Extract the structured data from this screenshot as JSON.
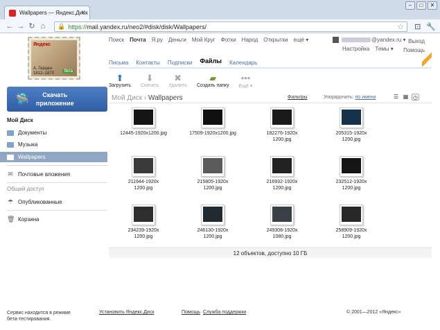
{
  "browser": {
    "tab_title": "Wallpapers — Яндекс.Диск",
    "url_scheme": "https://",
    "url_rest": "mail.yandex.ru/neo2/#disk/disk/Wallpapers/"
  },
  "logo": {
    "brand": "Яндекс",
    "name": "А. Герцен",
    "years": "1812–1870",
    "badge": "бета"
  },
  "topnav": [
    "Поиск",
    "Почта",
    "Я.ру",
    "Деньги",
    "Мой Круг",
    "Фотки",
    "Народ",
    "Открытки",
    "ещё ▾"
  ],
  "user": {
    "email_suffix": "@yandex.ru ▾",
    "settings": "Настройка",
    "themes": "Темы ▾",
    "exit": "Выход",
    "help": "Помощь"
  },
  "svctabs": [
    "Письма",
    "Контакты",
    "Подписки",
    "Файлы",
    "Календарь"
  ],
  "actions": [
    {
      "icon": "upload-icon",
      "glyph": "⬆",
      "label": "Загрузить"
    },
    {
      "icon": "download-icon",
      "glyph": "⬇",
      "label": "Скачать"
    },
    {
      "icon": "delete-icon",
      "glyph": "✖",
      "label": "Удалить"
    },
    {
      "icon": "new-folder-icon",
      "glyph": "▰",
      "label": "Создать папку"
    },
    {
      "icon": "more-icon",
      "glyph": "•••",
      "label": "Ещё ▾"
    }
  ],
  "breadcrumb": {
    "root": "Мой Диск",
    "sep": "›",
    "current": "Wallpapers"
  },
  "filters": "Фильтры",
  "sort": {
    "label": "Упорядочить:",
    "value": "по имени"
  },
  "sidebar": {
    "download_app": [
      "Скачать",
      "приложение"
    ],
    "title": "Мой Диск",
    "items": [
      "Документы",
      "Музыка",
      "Wallpapers"
    ],
    "attachments": "Почтовые вложения",
    "shared_section": "Общий доступ",
    "published": "Опубликованные",
    "trash": "Корзина"
  },
  "files": [
    {
      "name": [
        "12445-1920x1200.jpg"
      ],
      "shade": "#151515"
    },
    {
      "name": [
        "17509-1920x1200.jpg"
      ],
      "shade": "#101010"
    },
    {
      "name": [
        "182276-1920x",
        "1200.jpg"
      ],
      "shade": "#1a1a1a"
    },
    {
      "name": [
        "205315-1920x",
        "1200.jpg"
      ],
      "shade": "#16314a"
    },
    {
      "name": [
        "211944-1920x",
        "1200.jpg"
      ],
      "shade": "#3a3a3a"
    },
    {
      "name": [
        "215805-1920x",
        "1200.jpg"
      ],
      "shade": "#5a5a5a"
    },
    {
      "name": [
        "216932-1920x",
        "1200.jpg"
      ],
      "shade": "#222"
    },
    {
      "name": [
        "232512-1920x",
        "1200.jpg"
      ],
      "shade": "#141414"
    },
    {
      "name": [
        "234239-1920x",
        "1200.jpg"
      ],
      "shade": "#2e2e2e"
    },
    {
      "name": [
        "246130-1920x",
        "1200.jpg"
      ],
      "shade": "#1f2a33"
    },
    {
      "name": [
        "249308-1920x",
        "1080.jpg"
      ],
      "shade": "#3a4048"
    },
    {
      "name": [
        "258909-1920x",
        "1200.jpg"
      ],
      "shade": "#282828"
    }
  ],
  "status": "12 объектов, доступно 10 ГБ",
  "footer": {
    "note": [
      "Сервис находится в режиме",
      "бета-тестирования."
    ],
    "install": "Установить Яндекс.Диск",
    "help": "Помощь",
    "support": "Служба поддержки",
    "copyright": "© 2001—2012 «Яндекс»"
  }
}
